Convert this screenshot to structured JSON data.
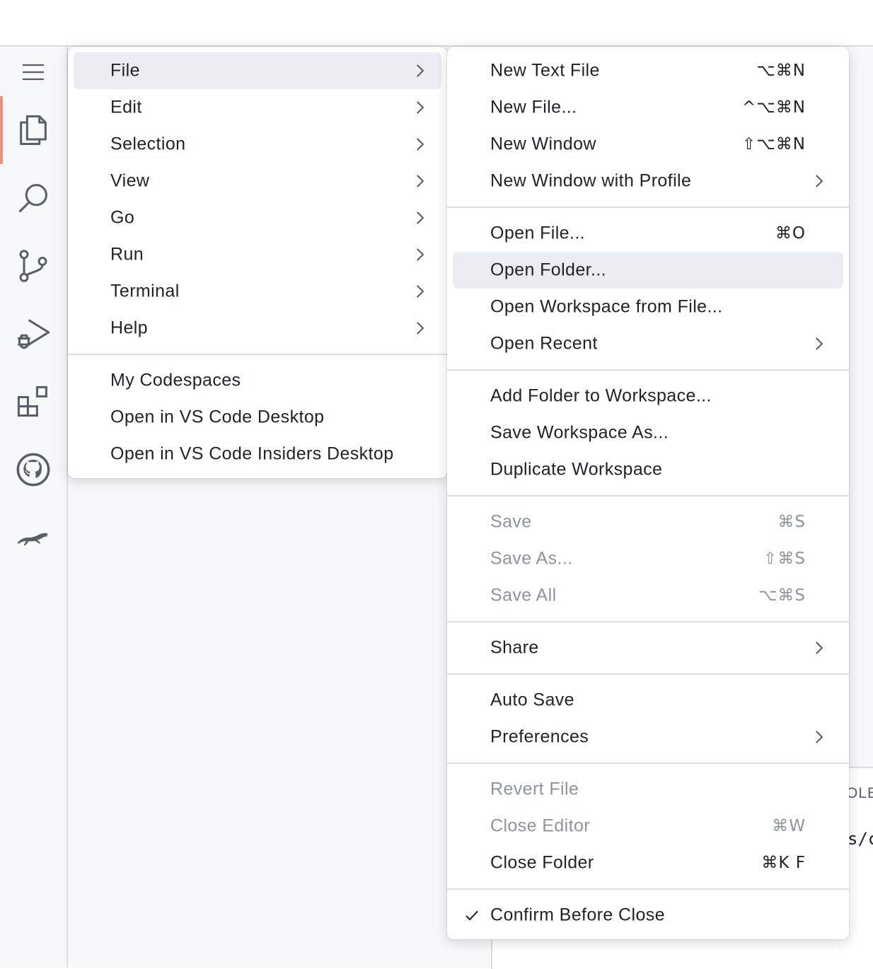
{
  "main_menu": {
    "items": [
      {
        "label": "File"
      },
      {
        "label": "Edit"
      },
      {
        "label": "Selection"
      },
      {
        "label": "View"
      },
      {
        "label": "Go"
      },
      {
        "label": "Run"
      },
      {
        "label": "Terminal"
      },
      {
        "label": "Help"
      }
    ],
    "extra_items": [
      {
        "label": "My Codespaces"
      },
      {
        "label": "Open in VS Code Desktop"
      },
      {
        "label": "Open in VS Code Insiders Desktop"
      }
    ]
  },
  "file_menu": {
    "items": [
      {
        "label": "New Text File",
        "shortcut": "⌥⌘N"
      },
      {
        "label": "New File...",
        "shortcut": "^⌥⌘N"
      },
      {
        "label": "New Window",
        "shortcut": "⇧⌥⌘N"
      },
      {
        "label": "New Window with Profile"
      },
      {
        "label": "Open File...",
        "shortcut": "⌘O"
      },
      {
        "label": "Open Folder..."
      },
      {
        "label": "Open Workspace from File..."
      },
      {
        "label": "Open Recent"
      },
      {
        "label": "Add Folder to Workspace..."
      },
      {
        "label": "Save Workspace As..."
      },
      {
        "label": "Duplicate Workspace"
      },
      {
        "label": "Save",
        "shortcut": "⌘S"
      },
      {
        "label": "Save As...",
        "shortcut": "⇧⌘S"
      },
      {
        "label": "Save All",
        "shortcut": "⌥⌘S"
      },
      {
        "label": "Share"
      },
      {
        "label": "Auto Save"
      },
      {
        "label": "Preferences"
      },
      {
        "label": "Revert File"
      },
      {
        "label": "Close Editor",
        "shortcut": "⌘W"
      },
      {
        "label": "Close Folder",
        "shortcut": "⌘K F"
      },
      {
        "label": "Confirm Before Close"
      }
    ]
  },
  "panel": {
    "tab_label_partial": "OLE",
    "text_partial": "s/c"
  },
  "activity_bar": {
    "icons": [
      "menu-icon",
      "explorer-icon",
      "search-icon",
      "source-control-icon",
      "run-debug-icon",
      "extensions-icon",
      "github-icon",
      "leaping-cat-icon"
    ]
  },
  "colors": {
    "accent": "#fd8c73",
    "highlight": "#eaeef2",
    "disabled_text": "#8c959f",
    "icon": "#57606a"
  }
}
